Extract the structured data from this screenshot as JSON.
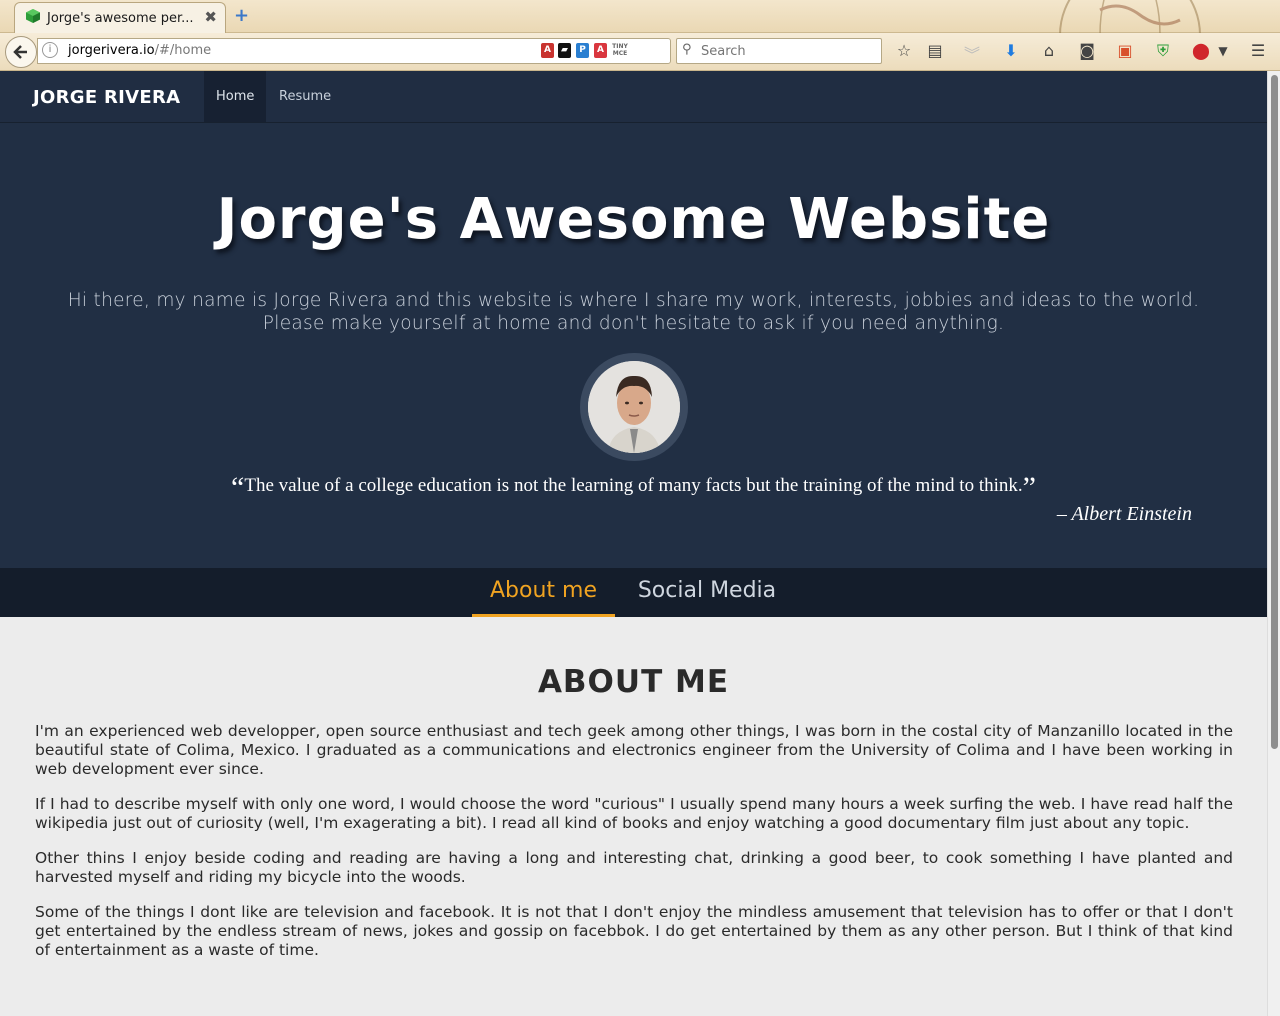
{
  "browser": {
    "tab_title": "Jorge's awesome per...",
    "url_host": "jorgerivera.io",
    "url_rest": "/#/home",
    "search_placeholder": "Search",
    "new_tab_label": "+",
    "close_label": "✖"
  },
  "site": {
    "brand": "JORGE RIVERA",
    "nav": [
      "Home",
      "Resume"
    ]
  },
  "hero": {
    "title": "Jorge's Awesome Website",
    "intro_line1": "Hi there, my name is Jorge Rivera and this website is where I share my work, interests, jobbies and ideas to the world.",
    "intro_line2": "Please make yourself at home and don't hesitate to ask if you need anything.",
    "quote": "The value of a college education is not the learning of many facts but the training of the mind to think.",
    "quote_open": "“",
    "quote_close": "”",
    "author": "– Albert Einstein"
  },
  "tabs": [
    "About me",
    "Social Media"
  ],
  "about": {
    "heading": "ABOUT ME",
    "paragraphs": [
      "I'm an experienced web developper, open source enthusiast and tech geek among other things, I was born in the costal city of Manzanillo located in the beautiful state of Colima, Mexico. I graduated as a communications and electronics engineer from the University of Colima and I have been working in web development ever since.",
      "If I had to describe myself with only one word, I would choose the word \"curious\" I usually spend many hours a week surfing the web. I have read half the wikipedia just out of curiosity (well, I'm exagerating a bit). I read all kind of books and enjoy watching a good documentary film just about any topic.",
      "Other thins I enjoy beside coding and reading are having a long and interesting chat, drinking a good beer, to cook something I have planted and harvested myself and riding my bicycle into the woods.",
      "Some of the things I dont like are television and facebook. It is not that I don't enjoy the mindless amusement that television has to offer or that I don't get entertained by the endless stream of news, jokes and gossip on facebbok. I do get entertained by them as any other person. But I think of that kind of entertainment as a waste of time."
    ]
  },
  "colors": {
    "nav_bg": "#202d42",
    "hero_bg": "#212f44",
    "tab_bar_bg": "#141d2b",
    "accent": "#f0a321",
    "content_bg": "#ececec"
  }
}
